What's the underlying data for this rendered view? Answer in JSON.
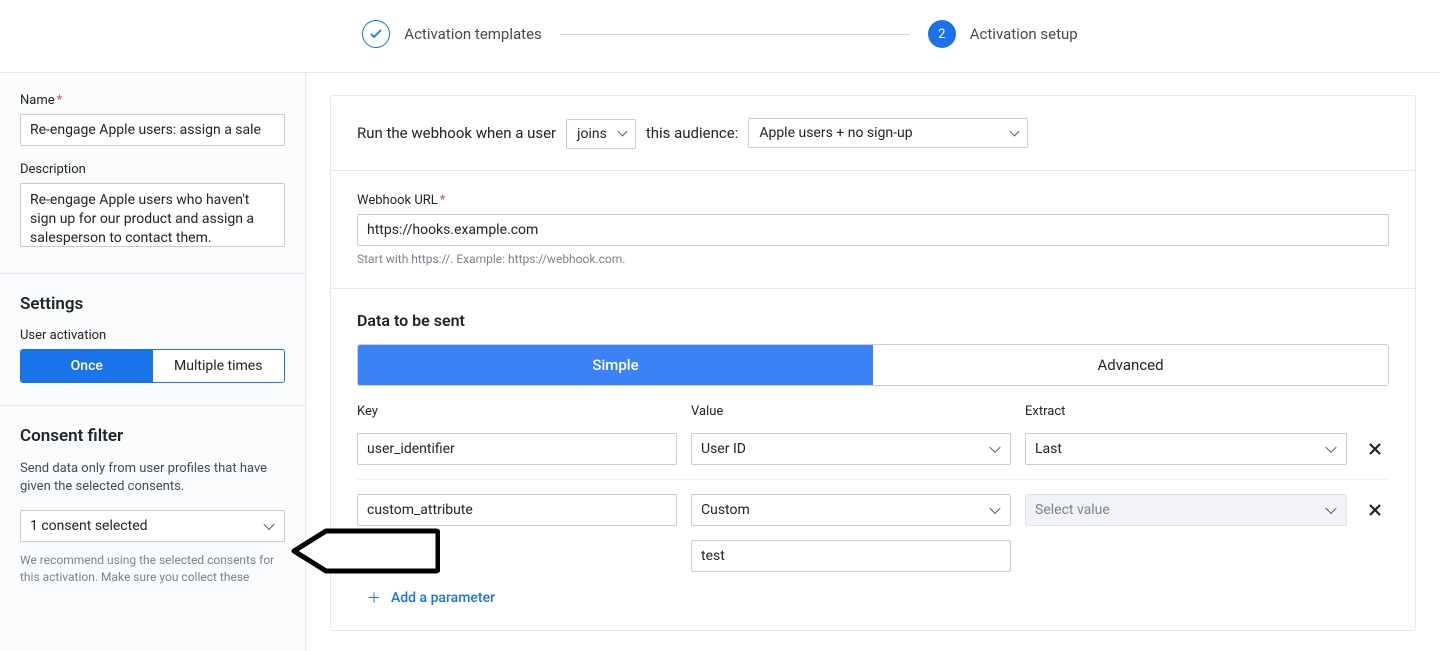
{
  "stepper": {
    "steps": [
      {
        "label": "Activation templates",
        "state": "done"
      },
      {
        "label": "Activation setup",
        "number": "2",
        "state": "active"
      }
    ]
  },
  "sidebar": {
    "name": {
      "label": "Name",
      "value": "Re-engage Apple users: assign a sale"
    },
    "description": {
      "label": "Description",
      "value": "Re-engage Apple users who haven't sign up for our product and assign a salesperson to contact them."
    },
    "settings": {
      "heading": "Settings",
      "userActivation": {
        "label": "User activation",
        "options": [
          "Once",
          "Multiple times"
        ],
        "active": "Once"
      }
    },
    "consent": {
      "heading": "Consent filter",
      "help": "Send data only from user profiles that have given the selected consents.",
      "selected": "1 consent selected",
      "footnote": "We recommend using the selected consents for this activation. Make sure you collect these"
    }
  },
  "main": {
    "runLine": {
      "prefix": "Run the webhook when a user",
      "mode": "joins",
      "mid": "this audience:",
      "audience": "Apple users + no sign-up"
    },
    "webhook": {
      "label": "Webhook URL",
      "value": "https://hooks.example.com",
      "hint": "Start with https://. Example: https://webhook.com."
    },
    "dataToSend": {
      "heading": "Data to be sent",
      "tabs": [
        "Simple",
        "Advanced"
      ],
      "activeTab": "Simple",
      "columns": {
        "key": "Key",
        "value": "Value",
        "extract": "Extract"
      },
      "rows": [
        {
          "key": "user_identifier",
          "value": "User ID",
          "extract": "Last"
        },
        {
          "key": "custom_attribute",
          "value": "Custom",
          "extract_placeholder": "Select value",
          "custom_value": "test"
        }
      ],
      "addLabel": "Add a parameter"
    }
  }
}
